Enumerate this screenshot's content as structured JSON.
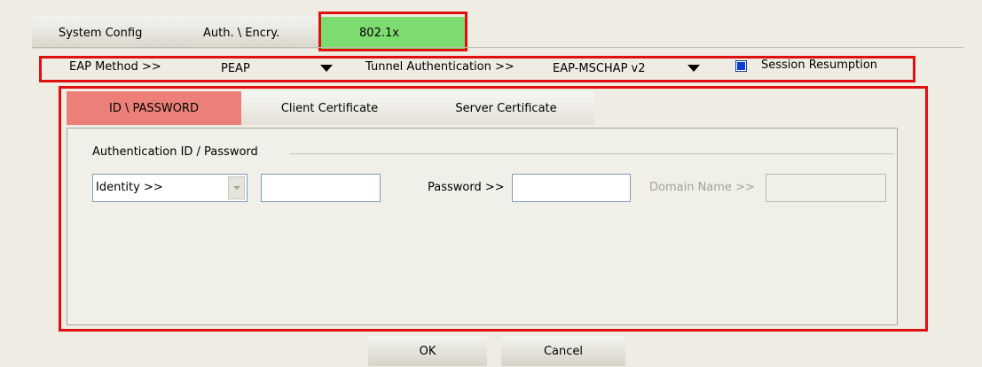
{
  "tabs": [
    {
      "label": "System Config"
    },
    {
      "label": "Auth. \\ Encry."
    },
    {
      "label": "802.1x"
    }
  ],
  "eap": {
    "method_label": "EAP Method >>",
    "method_value": "PEAP",
    "tunnel_label": "Tunnel Authentication >>",
    "tunnel_value": "EAP-MSCHAP v2",
    "session_resumption_label": "Session Resumption",
    "session_resumption_checked": true
  },
  "subtabs": [
    {
      "label": "ID \\ PASSWORD"
    },
    {
      "label": "Client Certificate"
    },
    {
      "label": "Server Certificate"
    }
  ],
  "auth": {
    "group_label": "Authentication ID / Password",
    "identity_select": "Identity >>",
    "identity_value": "",
    "password_label": "Password >>",
    "password_value": "",
    "domain_label": "Domain Name >>",
    "domain_value": ""
  },
  "buttons": {
    "ok": "OK",
    "cancel": "Cancel"
  },
  "colors": {
    "active_tab": "#7ddc6e",
    "active_subtab": "#ec8079",
    "highlight": "#e01010"
  }
}
